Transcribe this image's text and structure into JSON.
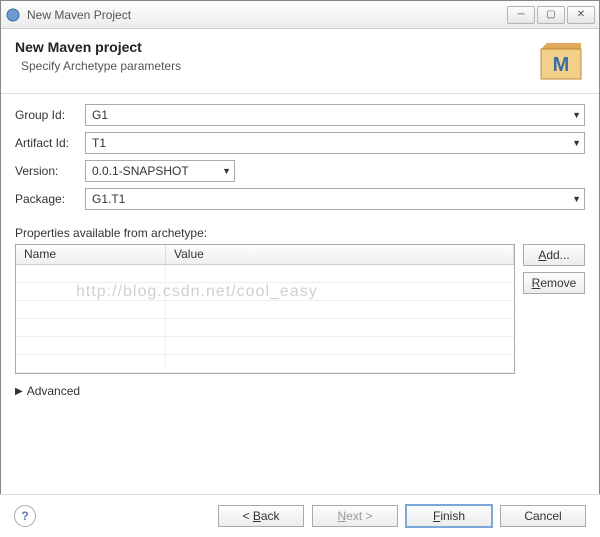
{
  "window": {
    "title": "New Maven Project"
  },
  "header": {
    "title": "New Maven project",
    "subtitle": "Specify Archetype parameters"
  },
  "form": {
    "groupId": {
      "label": "Group Id:",
      "value": "G1"
    },
    "artifactId": {
      "label": "Artifact Id:",
      "value": "T1"
    },
    "version": {
      "label": "Version:",
      "value": "0.0.1-SNAPSHOT"
    },
    "package": {
      "label": "Package:",
      "value": "G1.T1"
    }
  },
  "properties": {
    "label": "Properties available from archetype:",
    "columns": {
      "name": "Name",
      "value": "Value"
    },
    "rows": []
  },
  "buttons": {
    "add": "Add...",
    "remove": "Remove",
    "back": "< Back",
    "next": "Next >",
    "finish": "Finish",
    "cancel": "Cancel"
  },
  "expander": {
    "label": "Advanced"
  },
  "watermark": "http://blog.csdn.net/cool_easy"
}
